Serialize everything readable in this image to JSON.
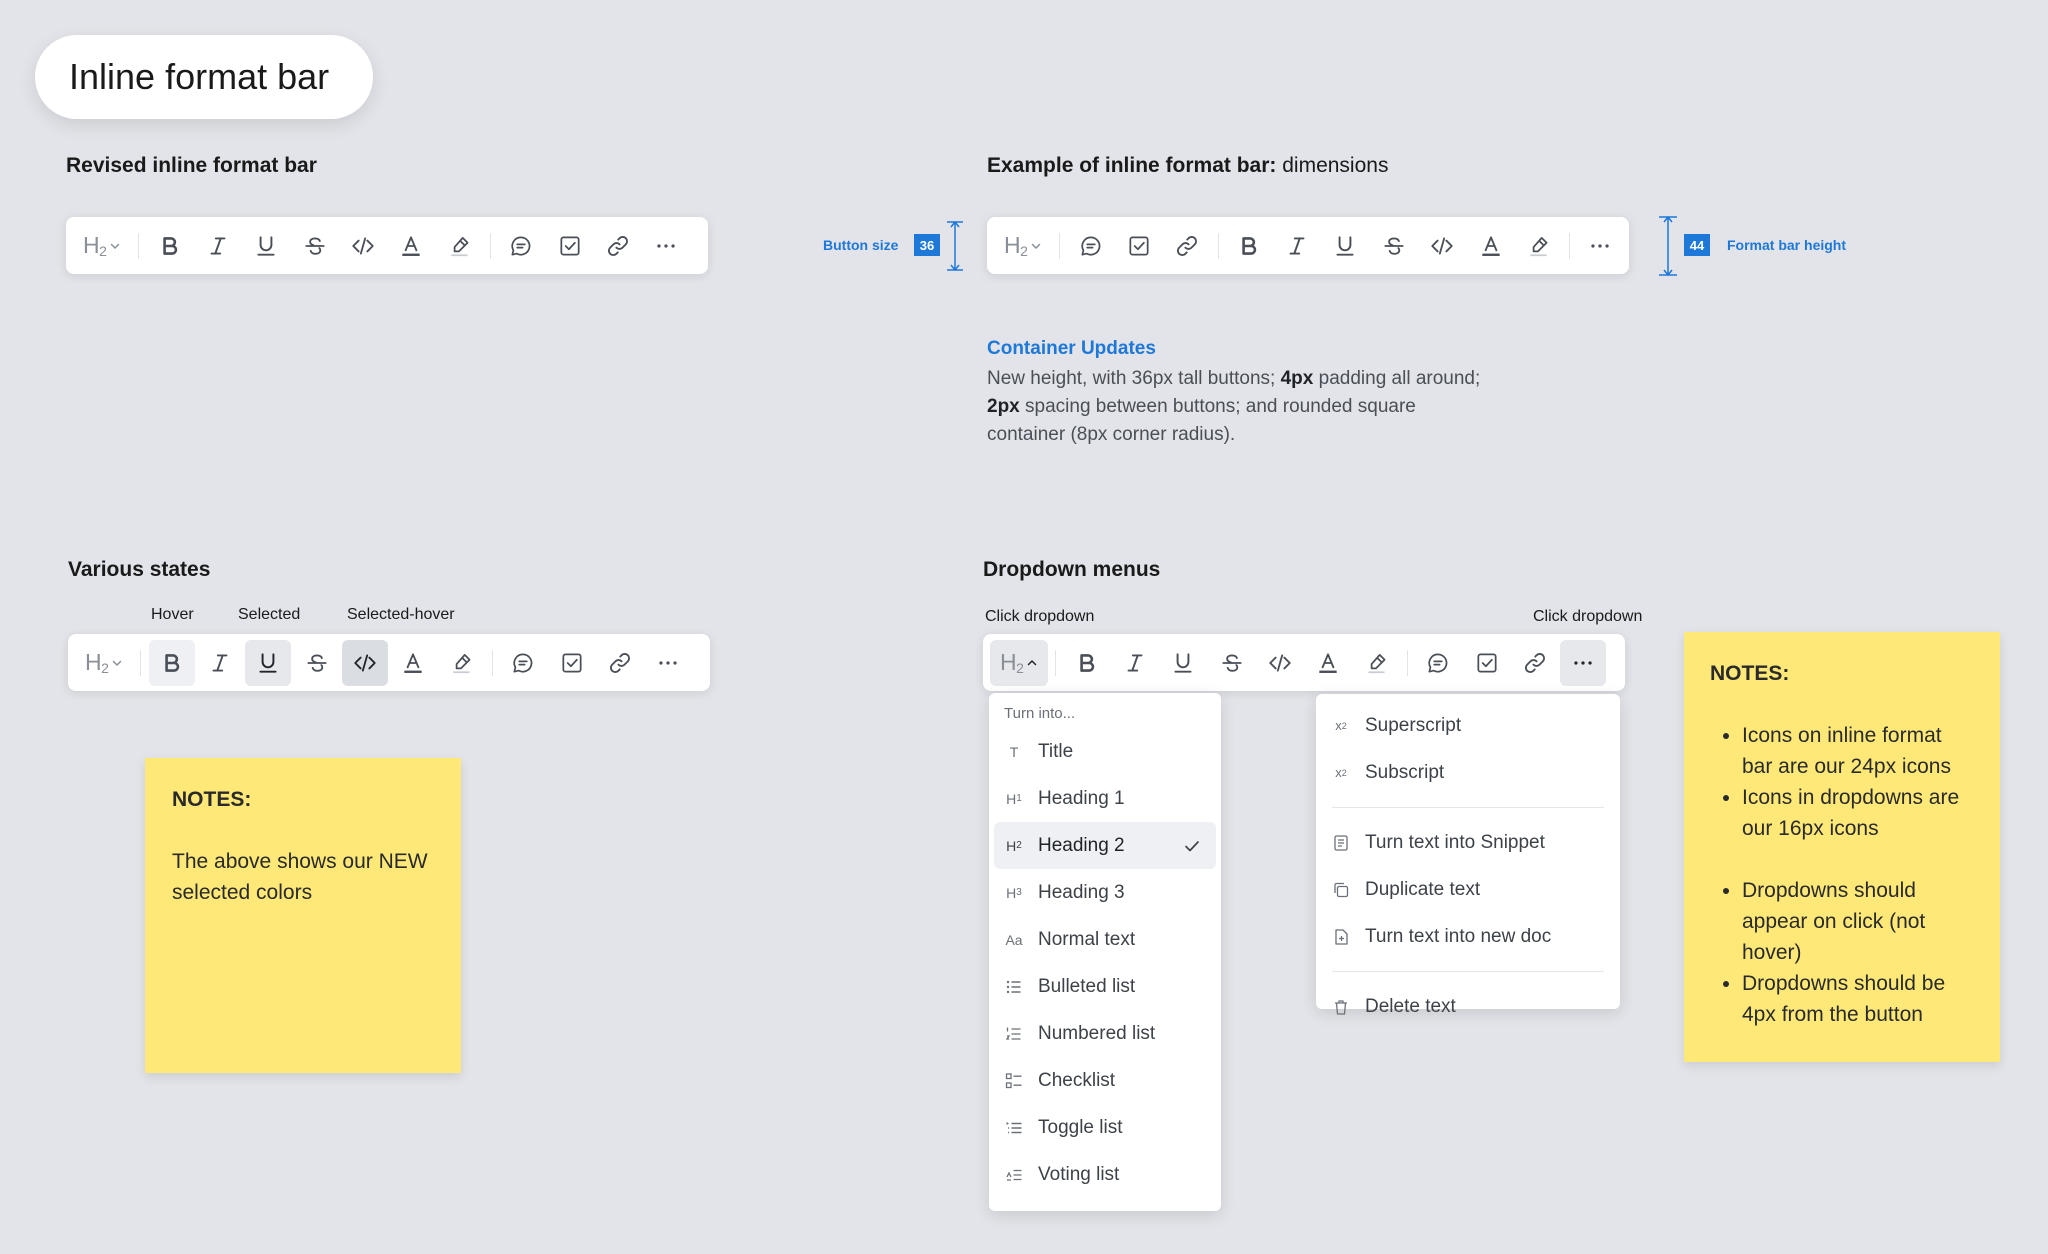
{
  "page_title": "Inline format bar",
  "sections": {
    "revised": "Revised inline format bar",
    "example_bold": "Example of inline format bar:",
    "example_light": " dimensions",
    "states": "Various states",
    "dropdowns": "Dropdown menus"
  },
  "toolbar": {
    "heading_label": "H",
    "heading_level": "2"
  },
  "measurements": {
    "button_size_label": "Button size",
    "button_size_value": "36",
    "bar_height_label": "Format bar height",
    "bar_height_value": "44"
  },
  "container_updates": {
    "title": "Container Updates",
    "line1_a": "New height, with 36px tall buttons; ",
    "line1_b": "4px",
    "line1_c": " padding all around; ",
    "line2_b": "2px",
    "line2_c": " spacing between buttons; and rounded square container (8px corner radius)."
  },
  "state_labels": {
    "hover": "Hover",
    "selected": "Selected",
    "selected_hover": "Selected-hover"
  },
  "dropdown_labels": {
    "left": "Click dropdown",
    "right": "Click dropdown"
  },
  "sticky_left": {
    "title": "NOTES:",
    "body": "The above shows our NEW selected colors"
  },
  "sticky_right": {
    "title": "NOTES:",
    "items": [
      "Icons on inline format bar are our 24px icons",
      "Icons in dropdowns are our 16px icons",
      "Dropdowns should appear on click (not hover)",
      "Dropdowns should be 4px from the button"
    ]
  },
  "turn_into_menu": {
    "heading": "Turn into...",
    "items": [
      {
        "icon": "T",
        "label": "Title"
      },
      {
        "icon": "H1",
        "label": "Heading 1"
      },
      {
        "icon": "H2",
        "label": "Heading 2"
      },
      {
        "icon": "H3",
        "label": "Heading 3"
      },
      {
        "icon": "Aa",
        "label": "Normal text"
      },
      {
        "icon": "bulleted-list-icon",
        "label": "Bulleted list"
      },
      {
        "icon": "numbered-list-icon",
        "label": "Numbered list"
      },
      {
        "icon": "checklist-icon",
        "label": "Checklist"
      },
      {
        "icon": "toggle-list-icon",
        "label": "Toggle list"
      },
      {
        "icon": "voting-list-icon",
        "label": "Voting list"
      }
    ],
    "selected_index": 2
  },
  "more_menu": {
    "items": [
      {
        "icon": "superscript-icon",
        "label": "Superscript"
      },
      {
        "icon": "subscript-icon",
        "label": "Subscript"
      },
      {
        "icon": "snippet-icon",
        "label": "Turn text into Snippet"
      },
      {
        "icon": "duplicate-icon",
        "label": "Duplicate text"
      },
      {
        "icon": "new-doc-icon",
        "label": "Turn text into new doc"
      },
      {
        "icon": "trash-icon",
        "label": "Delete text"
      }
    ]
  },
  "colors": {
    "background": "#e2e4e9",
    "accent_blue": "#1e78d8",
    "sticky_yellow": "#fde878",
    "selected_bg": "#e6e8ec"
  }
}
